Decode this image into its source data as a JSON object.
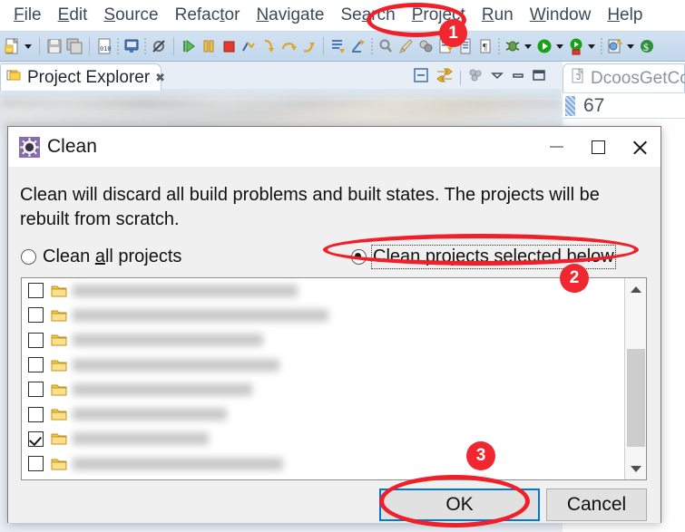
{
  "app": {
    "menubar": [
      {
        "label": "File",
        "mnemonic": "F"
      },
      {
        "label": "Edit",
        "mnemonic": "E"
      },
      {
        "label": "Source",
        "mnemonic": "S"
      },
      {
        "label": "Refactor",
        "mnemonic": "t"
      },
      {
        "label": "Navigate",
        "mnemonic": "N"
      },
      {
        "label": "Search",
        "mnemonic": "a"
      },
      {
        "label": "Project",
        "mnemonic": "P"
      },
      {
        "label": "Run",
        "mnemonic": "R"
      },
      {
        "label": "Window",
        "mnemonic": "W"
      },
      {
        "label": "Help",
        "mnemonic": "H"
      }
    ],
    "view_tab": {
      "title": "Project Explorer",
      "close_glyph": "✖"
    },
    "editor_tab": {
      "title": "DcoosGetCo",
      "line_number": "67"
    }
  },
  "dialog": {
    "title": "Clean",
    "icon": "clean-gear-icon",
    "description": "Clean will discard all build problems and built states.  The projects will be rebuilt from scratch.",
    "radio_options": [
      {
        "label": "Clean all projects",
        "mnemonic": "a",
        "selected": false
      },
      {
        "label": "Clean projects selected below",
        "mnemonic": "s",
        "selected": true
      }
    ],
    "project_list": [
      {
        "name": "",
        "checked": false,
        "blur_width": 248
      },
      {
        "name": "",
        "checked": false,
        "blur_width": 282
      },
      {
        "name": "",
        "checked": false,
        "blur_width": 210
      },
      {
        "name": "",
        "checked": false,
        "blur_width": 228
      },
      {
        "name": "",
        "checked": false,
        "blur_width": 198
      },
      {
        "name": "",
        "checked": false,
        "blur_width": 170
      },
      {
        "name": "",
        "checked": true,
        "blur_width": 150
      },
      {
        "name": "",
        "checked": false,
        "blur_width": 232
      }
    ],
    "scrollbar": {
      "up_glyph": "▲",
      "down_glyph": "▼",
      "thumb_top_pct": 35,
      "thumb_height_pct": 48
    },
    "buttons": {
      "ok": "OK",
      "cancel": "Cancel"
    },
    "window_controls": {
      "minimize": "minimize-icon",
      "maximize": "maximize-icon",
      "close": "close-icon"
    }
  },
  "annotations": {
    "accent_color": "#f0272f",
    "steps": [
      {
        "number": "1",
        "target": "Project"
      },
      {
        "number": "2",
        "target": "Clean projects selected below"
      },
      {
        "number": "3",
        "target": "OK"
      }
    ]
  }
}
